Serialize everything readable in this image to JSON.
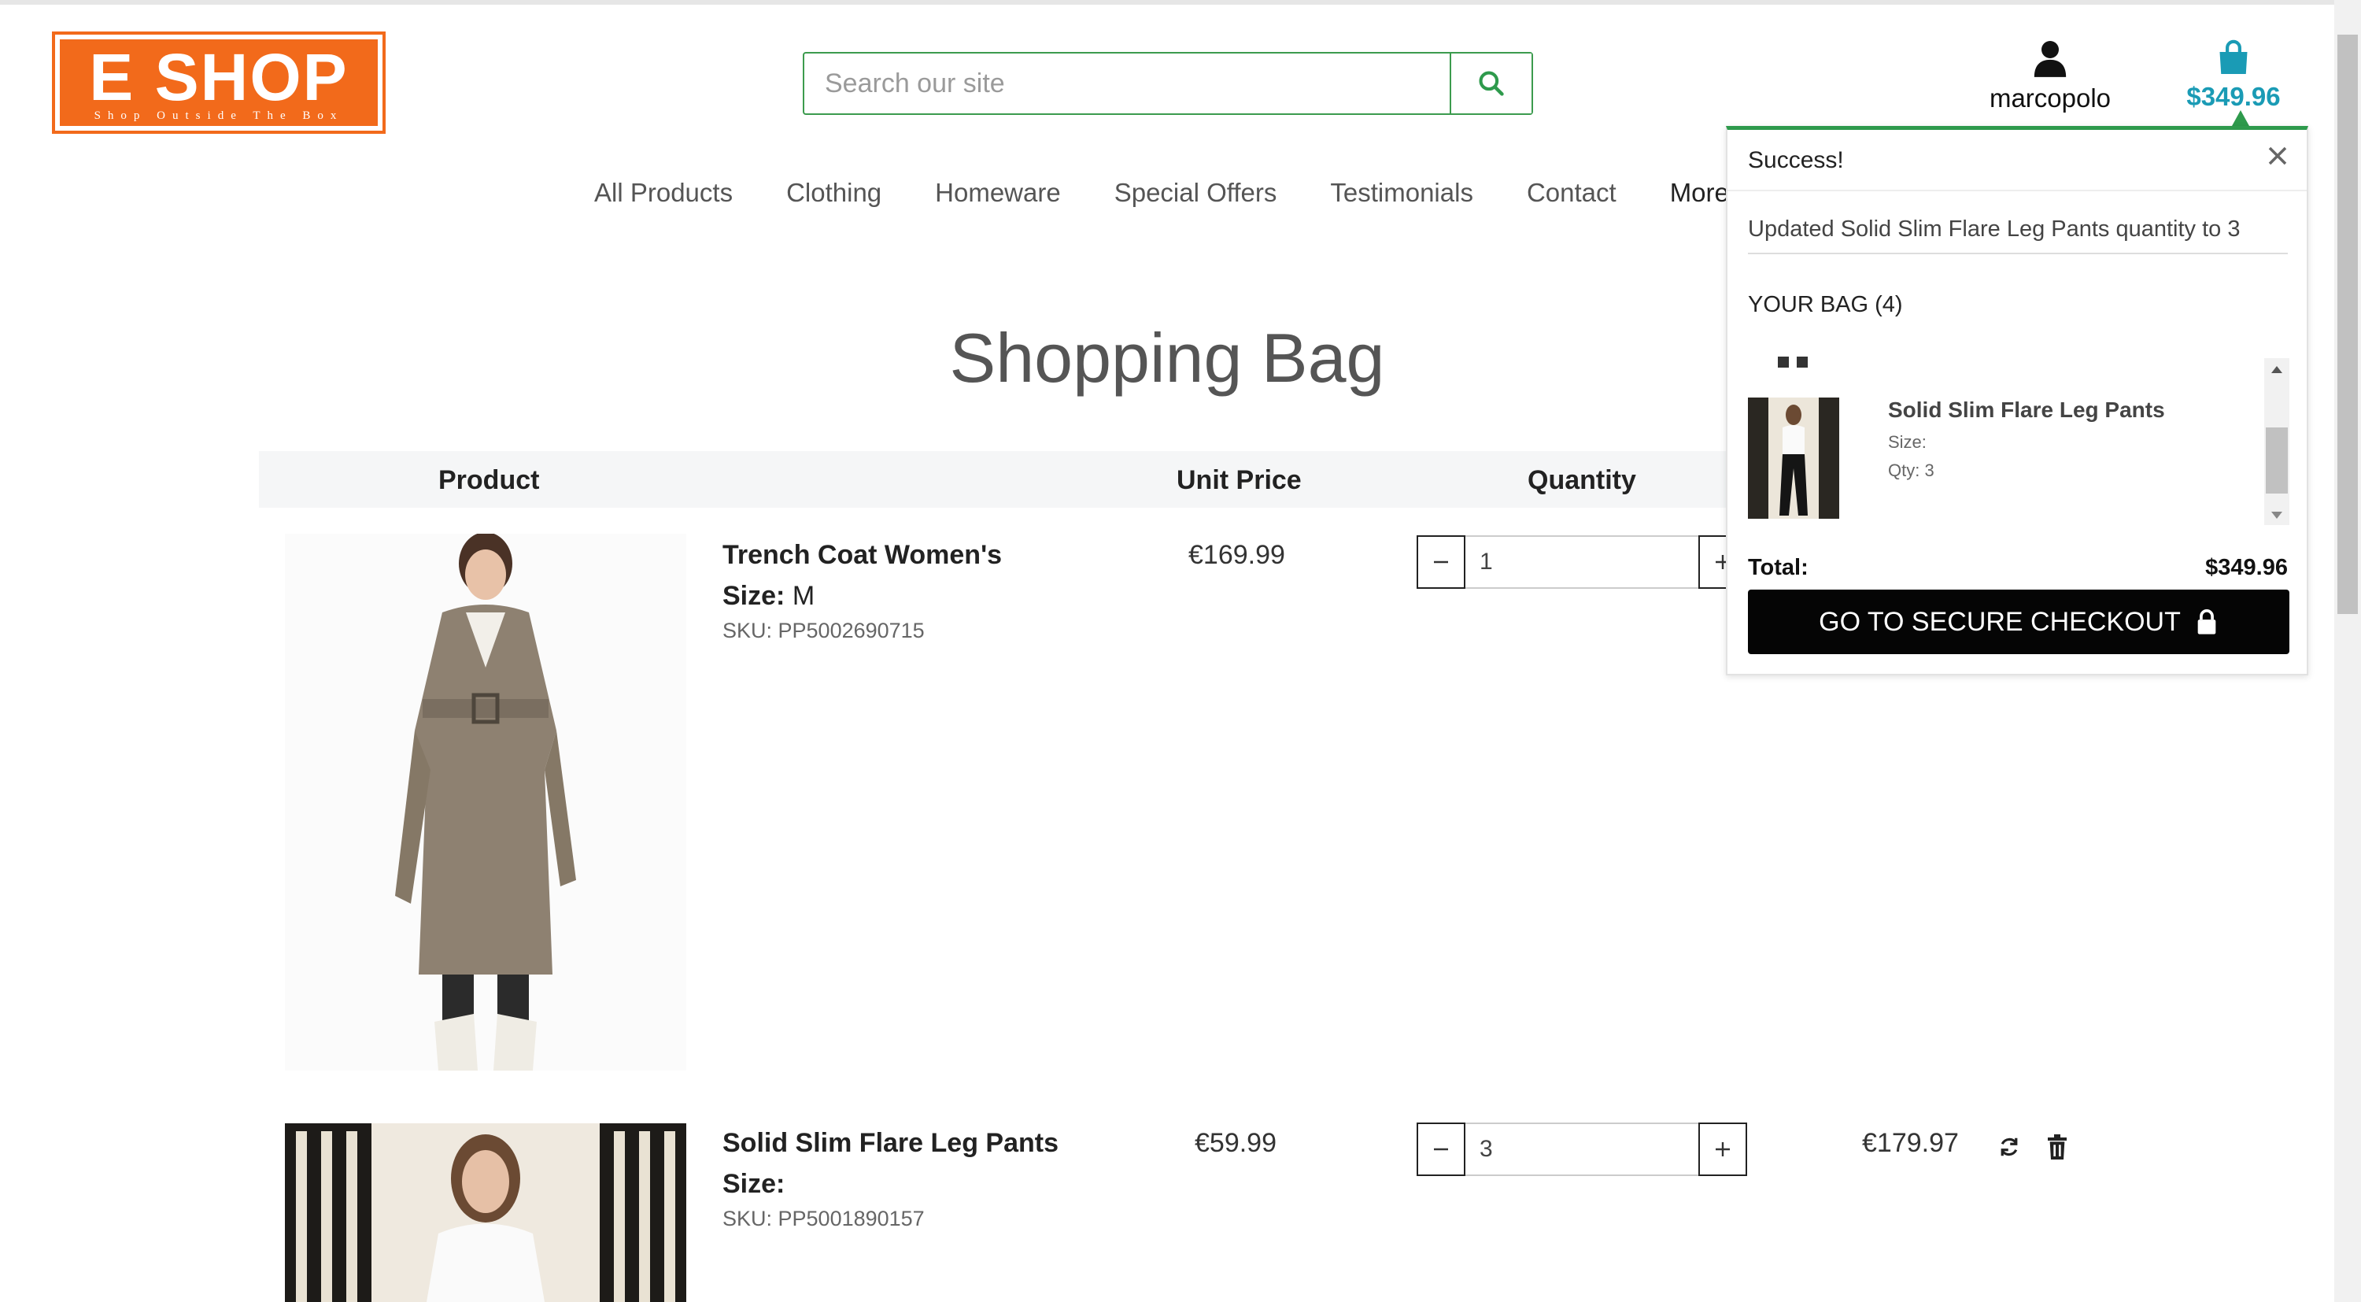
{
  "header": {
    "logo_text": "E SHOP",
    "logo_tagline": "Shop Outside The Box",
    "search_placeholder": "Search our site",
    "account_label": "marcopolo",
    "bag_total": "$349.96"
  },
  "nav": {
    "items": [
      "All Products",
      "Clothing",
      "Homeware",
      "Special Offers",
      "Testimonials",
      "Contact",
      "More"
    ]
  },
  "page": {
    "title": "Shopping Bag"
  },
  "table": {
    "headers": {
      "product": "Product",
      "unit_price": "Unit Price",
      "quantity": "Quantity"
    },
    "rows": [
      {
        "name": "Trench Coat Women's",
        "size_label": "Size:",
        "size_value": "M",
        "sku": "SKU: PP5002690715",
        "unit_price": "€169.99",
        "quantity": "1",
        "subtotal": ""
      },
      {
        "name": "Solid Slim Flare Leg Pants",
        "size_label": "Size:",
        "size_value": "",
        "sku": "SKU: PP5001890157",
        "unit_price": "€59.99",
        "quantity": "3",
        "subtotal": "€179.97"
      }
    ]
  },
  "popup": {
    "title": "Success!",
    "message": "Updated Solid Slim Flare Leg Pants quantity to 3",
    "bag_heading": "YOUR BAG (4)",
    "item": {
      "name": "Solid Slim Flare Leg Pants",
      "size": "Size:",
      "qty": "Qty: 3"
    },
    "total_label": "Total:",
    "total_value": "$349.96",
    "checkout_label": "GO TO SECURE CHECKOUT"
  },
  "colors": {
    "brand_orange": "#f26a1b",
    "accent_green": "#2e9a4c",
    "bag_teal": "#1a9bb5"
  }
}
